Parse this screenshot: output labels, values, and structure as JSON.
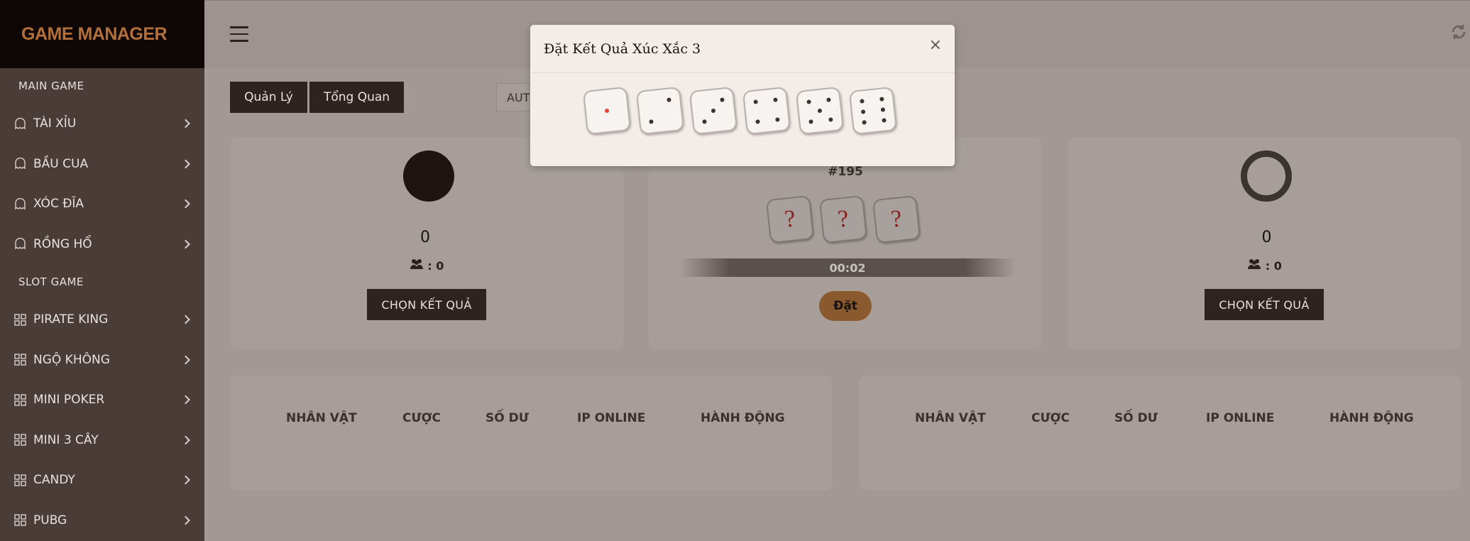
{
  "brand": "GAME MANAGER",
  "sidebar": {
    "sections": [
      {
        "title": "MAIN GAME",
        "items": [
          "TÀI XỈU",
          "BẦU CUA",
          "XÓC ĐĨA",
          "RỒNG HỔ"
        ]
      },
      {
        "title": "SLOT GAME",
        "items": [
          "PIRATE KING",
          "NGỘ KHÔNG",
          "MINI POKER",
          "MINI 3 CÂY",
          "CANDY",
          "PUBG"
        ]
      }
    ]
  },
  "tabs": {
    "manage": "Quản Lý",
    "overview": "Tổng Quan"
  },
  "auto_select": "AUT",
  "left_card": {
    "value": "0",
    "users": ": 0",
    "button": "CHỌN KẾT QUẢ"
  },
  "center_card": {
    "session": "#195",
    "dice": [
      "?",
      "?",
      "?"
    ],
    "timer": "00:02",
    "button": "Đặt"
  },
  "right_card": {
    "value": "0",
    "users": ": 0",
    "button": "CHỌN KẾT QUẢ"
  },
  "table_headers": [
    "NHÂN VẬT",
    "CƯỢC",
    "SỐ DƯ",
    "IP ONLINE",
    "HÀNH ĐỘNG"
  ],
  "modal": {
    "title": "Đặt Kết Quả Xúc Xắc 3",
    "close": "×",
    "dice_faces": [
      1,
      2,
      3,
      4,
      5,
      6
    ]
  },
  "icons": {
    "nav_main": "ghost-icon",
    "nav_slot": "grid-icon",
    "users": "users-icon",
    "refresh": "refresh-icon",
    "menu": "hamburger-icon"
  }
}
